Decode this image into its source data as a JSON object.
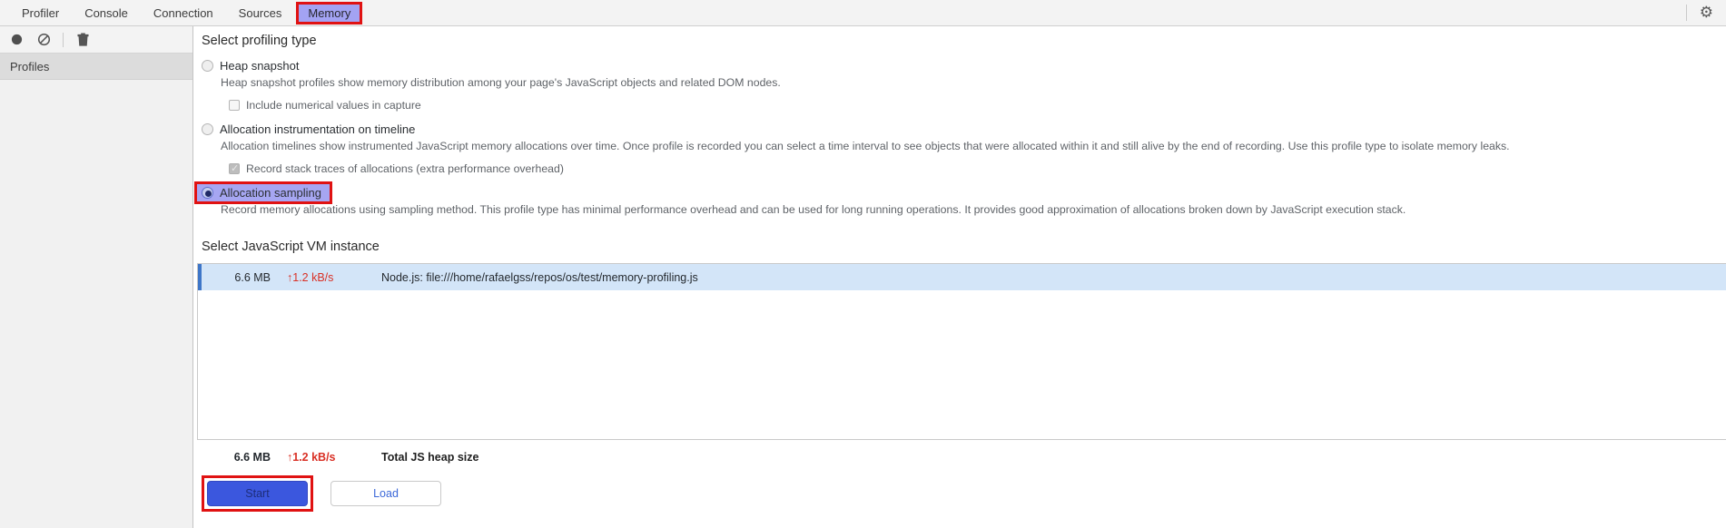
{
  "colors": {
    "annotation_red": "#e01212",
    "active_tab_highlight": "#a3a3f3",
    "selected_row_bg": "#d3e5f8",
    "row_accent_blue": "#3e76c8",
    "rate_red": "#d93025",
    "start_button_blue": "#3b57de",
    "load_text_blue": "#3c68d8"
  },
  "icons": {
    "record": "filled-circle",
    "clear": "circle-with-slash",
    "delete": "trash-can",
    "settings": "gear",
    "gear_glyph": "⚙"
  },
  "tabs": {
    "items": [
      {
        "label": "Profiler"
      },
      {
        "label": "Console"
      },
      {
        "label": "Connection"
      },
      {
        "label": "Sources"
      },
      {
        "label": "Memory"
      }
    ],
    "active": "Memory"
  },
  "sidebar": {
    "header": "Profiles"
  },
  "main": {
    "profiling_type": {
      "heading": "Select profiling type",
      "options": [
        {
          "label": "Heap snapshot",
          "selected": false,
          "description": "Heap snapshot profiles show memory distribution among your page's JavaScript objects and related DOM nodes.",
          "checkbox": {
            "label": "Include numerical values in capture",
            "checked": false
          }
        },
        {
          "label": "Allocation instrumentation on timeline",
          "selected": false,
          "description": "Allocation timelines show instrumented JavaScript memory allocations over time. Once profile is recorded you can select a time interval to see objects that were allocated within it and still alive by the end of recording. Use this profile type to isolate memory leaks.",
          "checkbox": {
            "label": "Record stack traces of allocations (extra performance overhead)",
            "checked": true
          }
        },
        {
          "label": "Allocation sampling",
          "selected": true,
          "annotated": true,
          "description": "Record memory allocations using sampling method. This profile type has minimal performance overhead and can be used for long running operations. It provides good approximation of allocations broken down by JavaScript execution stack."
        }
      ]
    },
    "vm_instance": {
      "heading": "Select JavaScript VM instance",
      "rows": [
        {
          "size": "6.6 MB",
          "rate": "↑1.2 kB/s",
          "name": "Node.js: file:///home/rafaelgss/repos/os/test/memory-profiling.js",
          "selected": true
        }
      ],
      "total": {
        "size": "6.6 MB",
        "rate": "↑1.2 kB/s",
        "label": "Total JS heap size"
      }
    },
    "actions": {
      "start_label": "Start",
      "load_label": "Load"
    }
  }
}
